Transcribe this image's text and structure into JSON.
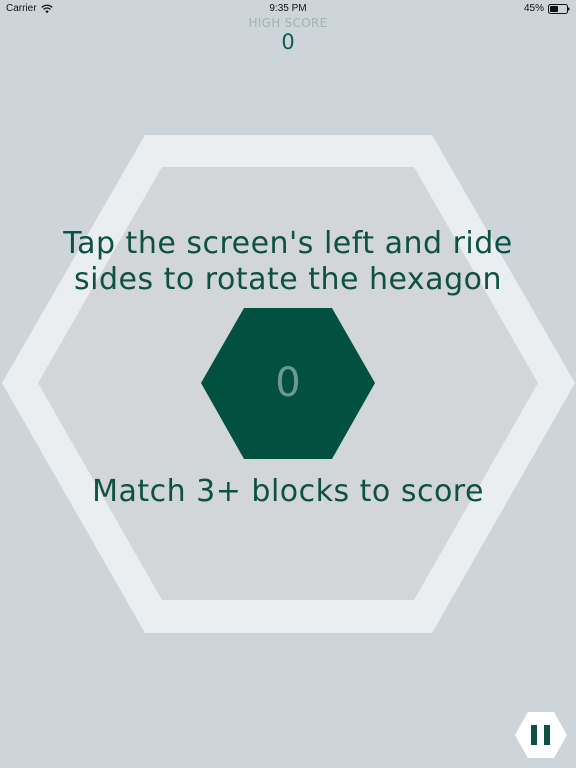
{
  "status_bar": {
    "carrier": "Carrier",
    "time": "9:35 PM",
    "battery": "45%",
    "wifi_icon": "wifi-icon",
    "battery_icon": "battery-icon"
  },
  "high_score": {
    "label": "HIGH SCORE",
    "value": "0"
  },
  "game": {
    "instruction_line1": "Tap the screen's left and ride",
    "instruction_line2": "sides to rotate the hexagon",
    "instruction_bottom": "Match 3+ blocks to score",
    "score": "0"
  },
  "controls": {
    "pause_icon": "pause-icon"
  },
  "colors": {
    "background": "#cdd5da",
    "outer_ring": "#ebeef0",
    "inner_field": "#d2d6d8",
    "center_hex": "#02503f",
    "text_primary": "#0d5145",
    "label_muted": "#9fb3b3"
  }
}
